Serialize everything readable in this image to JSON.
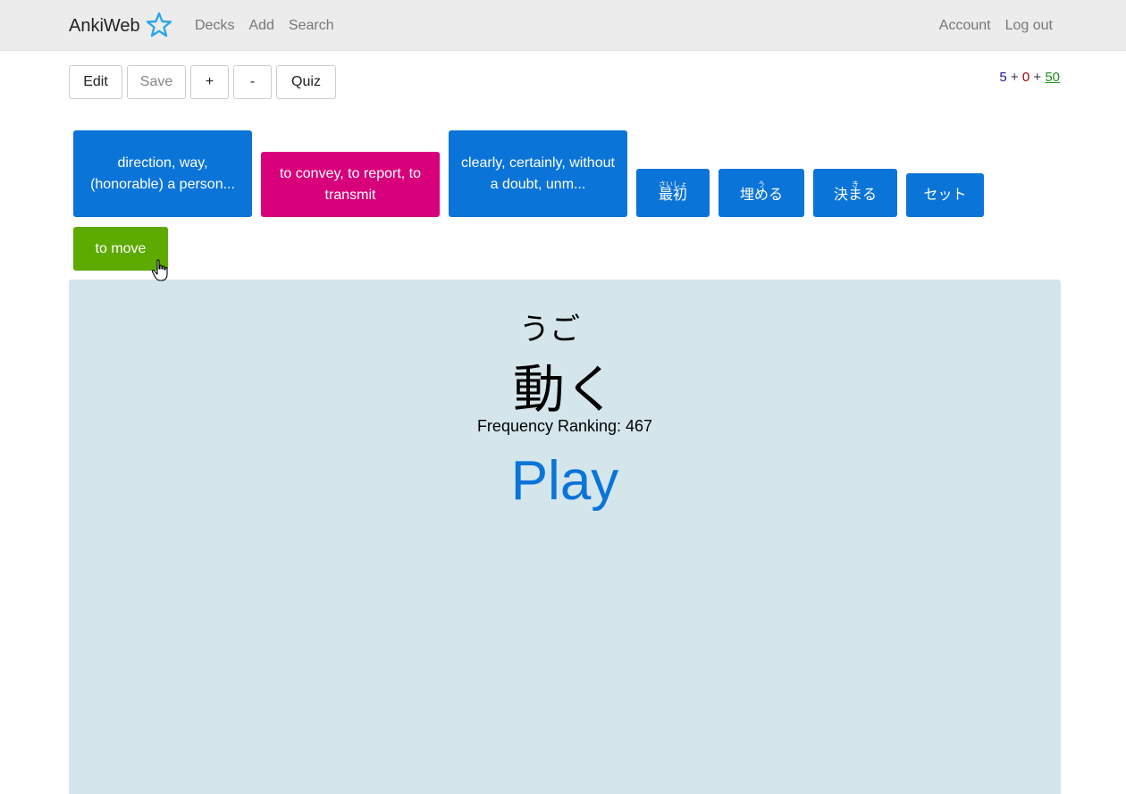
{
  "navbar": {
    "brand": "AnkiWeb",
    "links": [
      "Decks",
      "Add",
      "Search"
    ],
    "right_links": [
      "Account",
      "Log out"
    ]
  },
  "toolbar": {
    "edit": "Edit",
    "save": "Save",
    "plus": "+",
    "minus": "-",
    "quiz": "Quiz"
  },
  "counts": {
    "new": "5",
    "sep1": "+",
    "learn": "0",
    "sep2": "+",
    "due": "50"
  },
  "cards": [
    {
      "text": "direction, way, (honorable) a person...",
      "color": "#0b74d8"
    },
    {
      "text": "to convey, to report, to transmit",
      "color": "#d8007a"
    },
    {
      "text": "clearly, certainly, without a doubt, unm...",
      "color": "#0b74d8"
    },
    {
      "text": "最初",
      "reading": "さいしょ",
      "color": "#0b74d8"
    },
    {
      "text": "埋める",
      "reading": "う",
      "color": "#0b74d8"
    },
    {
      "text": "決まる",
      "reading": "き",
      "color": "#0b74d8"
    },
    {
      "text": "セット",
      "color": "#0b74d8"
    },
    {
      "text": "to move",
      "color": "#5daa00"
    }
  ],
  "panel": {
    "reading": "うご",
    "word": "動く",
    "frequency": "Frequency Ranking: 467",
    "play": "Play"
  }
}
